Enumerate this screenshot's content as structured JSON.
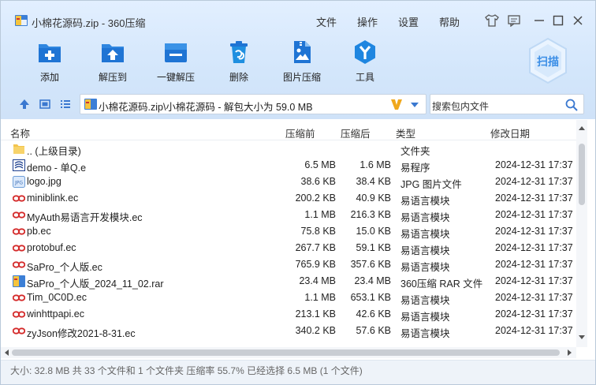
{
  "window": {
    "title": "小棉花源码.zip - 360压缩",
    "menu": [
      "文件",
      "操作",
      "设置",
      "帮助"
    ]
  },
  "toolbar": [
    {
      "label": "添加",
      "icon": "add-icon"
    },
    {
      "label": "解压到",
      "icon": "extract-to-icon"
    },
    {
      "label": "一键解压",
      "icon": "one-click-extract-icon"
    },
    {
      "label": "删除",
      "icon": "delete-icon"
    },
    {
      "label": "图片压缩",
      "icon": "image-compress-icon"
    },
    {
      "label": "工具",
      "icon": "tools-icon"
    }
  ],
  "scan_label": "扫描",
  "address": {
    "path": "小棉花源码.zip\\小棉花源码 - 解包大小为 59.0 MB"
  },
  "search": {
    "placeholder": "搜索包内文件"
  },
  "columns": {
    "name": "名称",
    "compressed": "压缩前",
    "uncompressed": "压缩后",
    "type": "类型",
    "modified": "修改日期"
  },
  "files": [
    {
      "name": ".. (上级目录)",
      "csize": "",
      "usize": "",
      "type": "文件夹",
      "date": "",
      "icon": "folder-icon"
    },
    {
      "name": "demo - 单Q.e",
      "csize": "6.5 MB",
      "usize": "1.6 MB",
      "type": "易程序",
      "date": "2024-12-31 17:37",
      "icon": "e-program-icon"
    },
    {
      "name": "logo.jpg",
      "csize": "38.6 KB",
      "usize": "38.4 KB",
      "type": "JPG 图片文件",
      "date": "2024-12-31 17:37",
      "icon": "jpg-file-icon"
    },
    {
      "name": "miniblink.ec",
      "csize": "200.2 KB",
      "usize": "40.9 KB",
      "type": "易语言模块",
      "date": "2024-12-31 17:37",
      "icon": "ec-module-icon"
    },
    {
      "name": "MyAuth易语言开发模块.ec",
      "csize": "1.1 MB",
      "usize": "216.3 KB",
      "type": "易语言模块",
      "date": "2024-12-31 17:37",
      "icon": "ec-module-icon"
    },
    {
      "name": "pb.ec",
      "csize": "75.8 KB",
      "usize": "15.0 KB",
      "type": "易语言模块",
      "date": "2024-12-31 17:37",
      "icon": "ec-module-icon"
    },
    {
      "name": "protobuf.ec",
      "csize": "267.7 KB",
      "usize": "59.1 KB",
      "type": "易语言模块",
      "date": "2024-12-31 17:37",
      "icon": "ec-module-icon"
    },
    {
      "name": "SaPro_个人版.ec",
      "csize": "765.9 KB",
      "usize": "357.6 KB",
      "type": "易语言模块",
      "date": "2024-12-31 17:37",
      "icon": "ec-module-icon"
    },
    {
      "name": "SaPro_个人版_2024_11_02.rar",
      "csize": "23.4 MB",
      "usize": "23.4 MB",
      "type": "360压缩 RAR 文件",
      "date": "2024-12-31 17:37",
      "icon": "rar-archive-icon"
    },
    {
      "name": "Tim_0C0D.ec",
      "csize": "1.1 MB",
      "usize": "653.1 KB",
      "type": "易语言模块",
      "date": "2024-12-31 17:37",
      "icon": "ec-module-icon"
    },
    {
      "name": "winhttpapi.ec",
      "csize": "213.1 KB",
      "usize": "42.6 KB",
      "type": "易语言模块",
      "date": "2024-12-31 17:37",
      "icon": "ec-module-icon"
    },
    {
      "name": "zyJson修改2021-8-31.ec",
      "csize": "340.2 KB",
      "usize": "57.6 KB",
      "type": "易语言模块",
      "date": "2024-12-31 17:37",
      "icon": "ec-module-icon"
    }
  ],
  "status": "大小: 32.8 MB 共 33 个文件和 1 个文件夹 压缩率 55.7% 已经选择 6.5 MB (1 个文件)"
}
